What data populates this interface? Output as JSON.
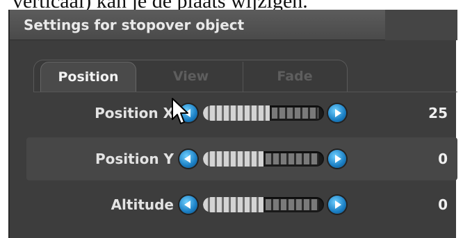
{
  "caption": "verticaal) kan je de plaats wijzigen.",
  "panel": {
    "title": "Settings for stopover object",
    "tabs": [
      {
        "label": "Position",
        "active": true
      },
      {
        "label": "View",
        "active": false
      },
      {
        "label": "Fade",
        "active": false
      }
    ],
    "rows": [
      {
        "label": "Position X",
        "value": "25",
        "slider_fraction": 0.55
      },
      {
        "label": "Position Y",
        "value": "0",
        "slider_fraction": 0.5
      },
      {
        "label": "Altitude",
        "value": "0",
        "slider_fraction": 0.5
      }
    ]
  },
  "icons": {
    "decrease": "arrow-left-icon",
    "increase": "arrow-right-icon",
    "cursor": "mouse-pointer-icon"
  },
  "colors": {
    "panel_bg": "#3d3d3d",
    "button_blue": "#1b7fc4",
    "text": "#e3e3e3"
  }
}
